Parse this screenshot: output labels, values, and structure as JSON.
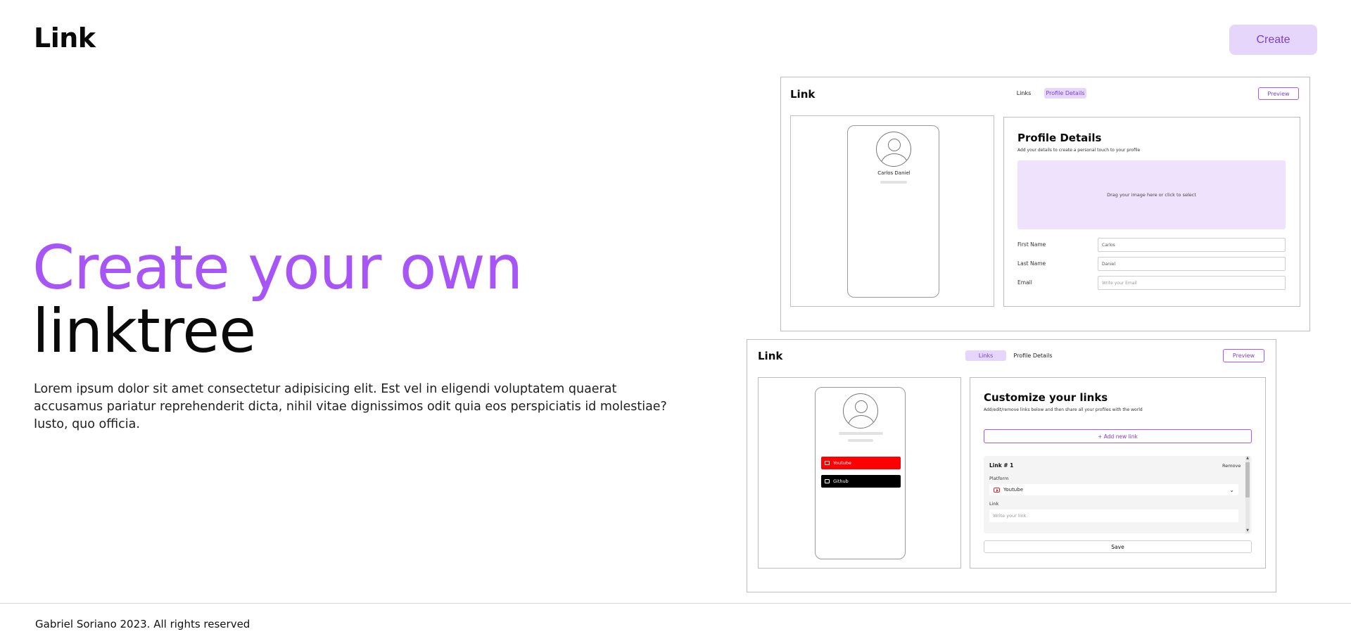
{
  "header": {
    "logo": "Link",
    "create_label": "Create"
  },
  "hero": {
    "title_line1": "Create your own",
    "title_line2": "linktree",
    "description": "Lorem ipsum dolor sit amet consectetur adipisicing elit. Est vel in eligendi voluptatem quaerat accusamus pariatur reprehenderit dicta, nihil vitae dignissimos odit quia eos perspiciatis id molestiae? Iusto, quo officia."
  },
  "mockup_profile": {
    "logo": "Link",
    "tabs": [
      "Links",
      "Profile Details"
    ],
    "active_tab": "Profile Details",
    "preview_label": "Preview",
    "phone_name": "Carlos Daniel",
    "title": "Profile Details",
    "subtitle": "Add your details to create a personal touch to your profile",
    "dropzone": "Drag your image here or click to select",
    "fields": [
      {
        "label": "First Name",
        "value": "Carlos"
      },
      {
        "label": "Last Name",
        "value": "Daniel"
      },
      {
        "label": "Email",
        "placeholder": "Write your Email"
      }
    ]
  },
  "mockup_links": {
    "logo": "Link",
    "tabs": [
      "Links",
      "Profile Details"
    ],
    "active_tab": "Links",
    "preview_label": "Preview",
    "phone_links": [
      {
        "label": "Youtube",
        "color": "#ff0000",
        "icon": "youtube-icon"
      },
      {
        "label": "Github",
        "color": "#000000",
        "icon": "github-icon"
      }
    ],
    "title": "Customize your links",
    "subtitle": "Add/edit/remove links below and then share all your profiles with the world",
    "add_link_label": "+ Add new link",
    "link_card": {
      "title": "Link # 1",
      "remove_label": "Remove",
      "platform_label": "Platform",
      "platform_value": "Youtube",
      "link_label": "Link",
      "link_placeholder": "Write your link"
    },
    "save_label": "Save"
  },
  "footer": {
    "text": "Gabriel Soriano 2023. All rights reserved"
  },
  "colors": {
    "accent": "#a855f7",
    "accent_light": "#e6d6fb",
    "youtube": "#ff0000"
  }
}
